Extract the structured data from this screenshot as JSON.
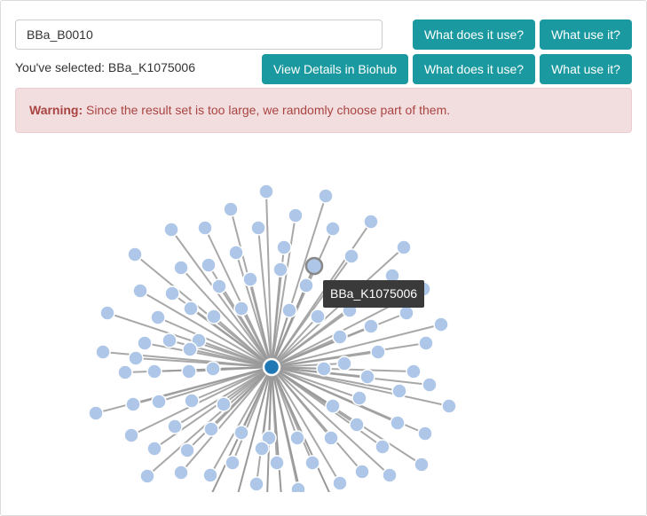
{
  "search": {
    "value": "BBa_B0010"
  },
  "top_buttons": {
    "uses": "What does it use?",
    "used_by": "What use it?"
  },
  "selection": {
    "prefix": "You've selected: ",
    "part": "BBa_K1075006",
    "details_button": "View Details in Biohub",
    "uses": "What does it use?",
    "used_by": "What use it?"
  },
  "warning": {
    "label": "Warning:",
    "message": " Since the result set is too large, we randomly choose part of them."
  },
  "tooltip": {
    "text": "BBa_K1075006"
  },
  "colors": {
    "button": "#1a9aa0",
    "node": "#aec7e8",
    "center_node": "#1f77b4",
    "edge": "#999999",
    "warning_bg": "#f2dede",
    "warning_text": "#a94442",
    "tooltip_bg": "#3a3a3a"
  }
}
